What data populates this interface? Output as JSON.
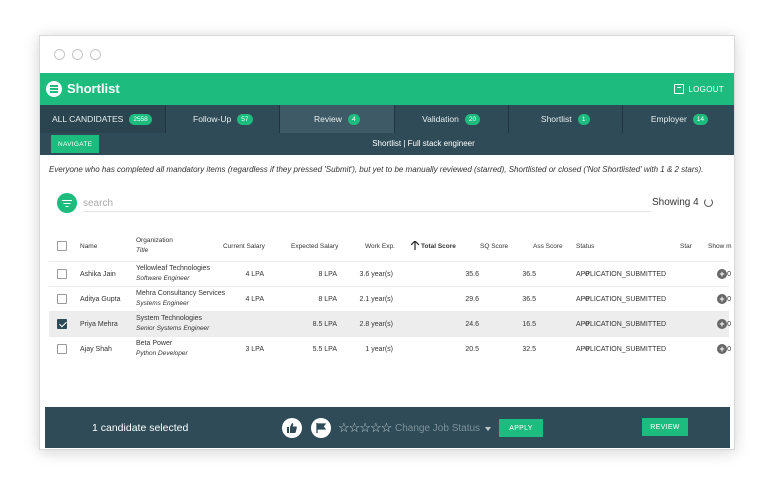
{
  "app": {
    "title": "Shortlist",
    "logout_label": "LOGOUT"
  },
  "tabs": [
    {
      "label": "ALL CANDIDATES",
      "count": "2558"
    },
    {
      "label": "Follow-Up",
      "count": "57"
    },
    {
      "label": "Review",
      "count": "4"
    },
    {
      "label": "Validation",
      "count": "20"
    },
    {
      "label": "Shortlist",
      "count": "1"
    },
    {
      "label": "Employer",
      "count": "14"
    }
  ],
  "subbar": {
    "navigate_label": "NAVIGATE",
    "title": "Shortlist | Full stack engineer"
  },
  "description": "Everyone who has completed all mandatory items (regardless if they pressed 'Submit'), but yet to be manually reviewed (starred), Shortlisted or closed ('Not Shortlisted' with 1 & 2 stars).",
  "search": {
    "placeholder": "search"
  },
  "showing": "Showing 4",
  "table": {
    "headers": {
      "name": "Name",
      "organization": "Organization",
      "title": "Title",
      "current_salary": "Current Salary",
      "expected_salary": "Expected Salary",
      "work_exp": "Work Exp.",
      "total_score": "Total Score",
      "sq_score": "SQ Score",
      "ass_score": "Ass Score",
      "status": "Status",
      "star": "Star",
      "show_more": "Show m"
    },
    "rows": [
      {
        "name": "Ashika Jain",
        "organization": "Yellowleaf Technologies",
        "title": "Software Engineer",
        "current_salary": "4 LPA",
        "expected_salary": "8 LPA",
        "work_exp": "3.6 year(s)",
        "total_score": "35.6",
        "sq_score": "36.5",
        "ass_score": "0",
        "status": "APPLICATION_SUBMITTED",
        "star": "0",
        "checked": false
      },
      {
        "name": "Aditya Gupta",
        "organization": "Mehra Consultancy Services",
        "title": "Systems Engineer",
        "current_salary": "4 LPA",
        "expected_salary": "8 LPA",
        "work_exp": "2.1 year(s)",
        "total_score": "29.6",
        "sq_score": "36.5",
        "ass_score": "0",
        "status": "APPLICATION_SUBMITTED",
        "star": "0",
        "checked": false
      },
      {
        "name": "Priya Mehra",
        "organization": "System Technologies",
        "title": "Senior Systems Engineer",
        "current_salary": "",
        "expected_salary": "8.5 LPA",
        "work_exp": "2.8 year(s)",
        "total_score": "24.6",
        "sq_score": "16.5",
        "ass_score": "0",
        "status": "APPLICATION_SUBMITTED",
        "star": "0",
        "checked": true
      },
      {
        "name": "Ajay Shah",
        "organization": "Beta Power",
        "title": "Python Developer",
        "current_salary": "3 LPA",
        "expected_salary": "5.5 LPA",
        "work_exp": "1 year(s)",
        "total_score": "20.5",
        "sq_score": "32.5",
        "ass_score": "0",
        "status": "APPLICATION_SUBMITTED",
        "star": "0",
        "checked": false
      }
    ]
  },
  "bottom": {
    "selected_text": "1 candidate selected",
    "stars": "☆☆☆☆☆",
    "status_placeholder": "Change Job Status",
    "apply_label": "APPLY",
    "review_label": "REVIEW"
  },
  "colors": {
    "accent": "#1dbb7d",
    "navy": "#2e4b57"
  },
  "icons": [
    "logo-icon",
    "logout-icon",
    "filter-icon",
    "refresh-icon",
    "sort-up-arrow-icon",
    "plus-circle-icon",
    "thumbs-up-icon",
    "flag-icon",
    "star-icon",
    "caret-down-icon"
  ]
}
